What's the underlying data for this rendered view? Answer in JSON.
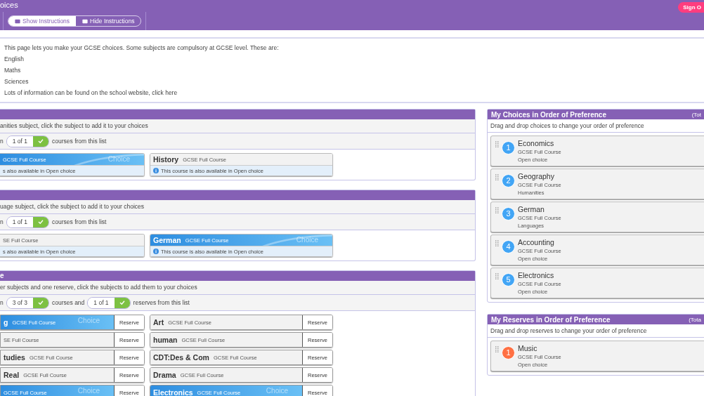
{
  "header": {
    "title": "oices",
    "toggle": [
      {
        "label": "Show Instructions",
        "selected": true
      },
      {
        "label": "Hide Instructions",
        "selected": false
      }
    ],
    "sign_out": "Sign O"
  },
  "instructions": {
    "intro": "This page lets you make your GCSE choices. Some subjects are compulsory at GCSE level. These are:",
    "subjects": [
      "English",
      "Maths",
      "Sciences"
    ],
    "footer": "Lots of information can be found on the school website, click here"
  },
  "sections": [
    {
      "kind": "notes",
      "prompt": "anities subject, click the subject to add it to your choices",
      "counter": [
        {
          "kind": "text",
          "text": "n"
        },
        {
          "kind": "pill",
          "text": "1 of 1"
        },
        {
          "kind": "text",
          "text": "courses from this list"
        }
      ],
      "courses": [
        {
          "course": "GCSE Full Course",
          "selected": true,
          "choice_label": "Choice",
          "note": "s also available in Open choice",
          "info_icon": false
        },
        {
          "name": "History",
          "course": "GCSE Full Course",
          "selected": false,
          "note": "This course is also available in Open choice",
          "info_icon": true
        }
      ]
    },
    {
      "kind": "notes",
      "prompt": "uage subject, click the subject to add it to your choices",
      "counter": [
        {
          "kind": "text",
          "text": "n"
        },
        {
          "kind": "pill",
          "text": "1 of 1"
        },
        {
          "kind": "text",
          "text": "courses from this list"
        }
      ],
      "courses": [
        {
          "course": "SE Full Course",
          "selected": false,
          "note": "s also available in Open choice",
          "info_icon": false
        },
        {
          "name": "German",
          "course": "GCSE Full Course",
          "selected": true,
          "choice_label": "Choice",
          "note": "This course is also available in Open choice",
          "info_icon": true
        }
      ]
    },
    {
      "kind": "reserve",
      "title": "e",
      "prompt": "er subjects and one reserve, click the subjects to add them to your choices",
      "counter": [
        {
          "kind": "text",
          "text": "n"
        },
        {
          "kind": "pill",
          "text": "3 of 3"
        },
        {
          "kind": "text",
          "text": "courses and"
        },
        {
          "kind": "pill",
          "text": "1 of 1"
        },
        {
          "kind": "text",
          "text": "reserves from this list"
        }
      ],
      "courses": [
        {
          "name": "g",
          "course": "GCSE Full Course",
          "selected": true,
          "choice_label": "Choice",
          "reserve": "Reserve"
        },
        {
          "name": "Art",
          "course": "GCSE Full Course",
          "selected": false,
          "reserve": "Reserve"
        },
        {
          "course": "SE Full Course",
          "selected": false,
          "reserve": "Reserve"
        },
        {
          "name": "human",
          "course": "GCSE Full Course",
          "selected": false,
          "reserve": "Reserve"
        },
        {
          "name": "tudies",
          "course": "GCSE Full Course",
          "selected": false,
          "reserve": "Reserve"
        },
        {
          "name": "CDT:Des & Com",
          "course": "GCSE Full Course",
          "selected": false,
          "reserve": "Reserve"
        },
        {
          "name": "Real",
          "course": "GCSE Full Course",
          "selected": false,
          "reserve": "Reserve"
        },
        {
          "name": "Drama",
          "course": "GCSE Full Course",
          "selected": false,
          "reserve": "Reserve"
        },
        {
          "course": "GCSE Full Course",
          "selected": true,
          "choice_label": "Choice",
          "reserve": "Reserve"
        },
        {
          "name": "Electronics",
          "course": "GCSE Full Course",
          "selected": true,
          "choice_label": "Choice",
          "reserve": "Reserve"
        }
      ]
    }
  ],
  "panels": [
    {
      "title": "My Choices in Order of Preference",
      "total": "(Tot",
      "hint": "Drag and drop choices to change your order of preference",
      "items": [
        {
          "rank": "1",
          "name": "Economics",
          "course": "GCSE Full Course",
          "group": "Open choice",
          "color": "#42a5f5"
        },
        {
          "rank": "2",
          "name": "Geography",
          "course": "GCSE Full Course",
          "group": "Humanities",
          "color": "#42a5f5"
        },
        {
          "rank": "3",
          "name": "German",
          "course": "GCSE Full Course",
          "group": "Languages",
          "color": "#42a5f5"
        },
        {
          "rank": "4",
          "name": "Accounting",
          "course": "GCSE Full Course",
          "group": "Open choice",
          "color": "#42a5f5"
        },
        {
          "rank": "5",
          "name": "Electronics",
          "course": "GCSE Full Course",
          "group": "Open choice",
          "color": "#42a5f5"
        }
      ]
    },
    {
      "title": "My Reserves in Order of Preference",
      "total": "(Tota",
      "hint": "Drag and drop reserves to change your order of preference",
      "items": [
        {
          "rank": "1",
          "name": "Music",
          "course": "GCSE Full Course",
          "group": "Open choice",
          "color": "#ff7043"
        }
      ]
    }
  ]
}
